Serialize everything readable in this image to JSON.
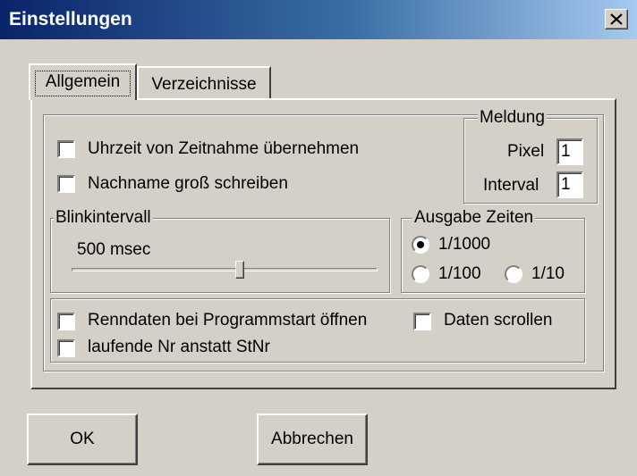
{
  "window": {
    "title": "Einstellungen",
    "close_icon": "close-icon"
  },
  "tabs": [
    {
      "label": "Allgemein",
      "active": true
    },
    {
      "label": "Verzeichnisse",
      "active": false
    }
  ],
  "options": {
    "uhrzeit_label": "Uhrzeit von Zeitnahme übernehmen",
    "uhrzeit_checked": false,
    "nachname_label": "Nachname groß schreiben",
    "nachname_checked": false
  },
  "meldung": {
    "legend": "Meldung",
    "pixel_label": "Pixel",
    "pixel_value": "1",
    "interval_label": "Interval",
    "interval_value": "1"
  },
  "blink": {
    "legend": "Blinkintervall",
    "value_text": "500 msec",
    "slider_fraction": 0.55
  },
  "ausgabe": {
    "legend": "Ausgabe Zeiten",
    "options": [
      {
        "label": "1/1000",
        "selected": true
      },
      {
        "label": "1/100",
        "selected": false
      },
      {
        "label": "1/10",
        "selected": false
      }
    ]
  },
  "bottom_options": {
    "renndaten_label": "Renndaten bei Programmstart öffnen",
    "renndaten_checked": false,
    "scrollen_label": "Daten scrollen",
    "scrollen_checked": false,
    "laufende_label": "laufende Nr anstatt StNr",
    "laufende_checked": false
  },
  "buttons": {
    "ok_label": "OK",
    "cancel_label": "Abbrechen"
  }
}
